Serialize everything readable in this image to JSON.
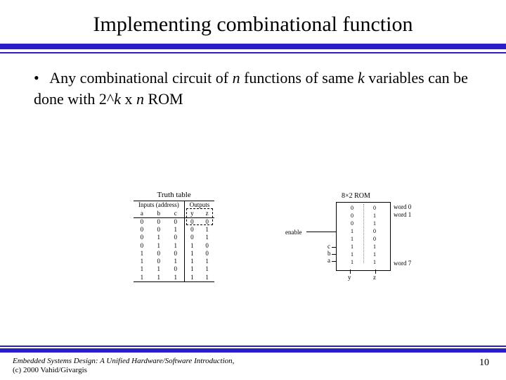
{
  "title": "Implementing combinational function",
  "bullet": {
    "marker": "•",
    "text_a": "Any combinational circuit of ",
    "n": "n",
    "text_b": " functions of same ",
    "k": "k",
    "text_c": " variables can be done with 2^",
    "k2": "k",
    "text_d": " x ",
    "n2": "n",
    "text_e": " ROM"
  },
  "truth_table": {
    "title": "Truth table",
    "group_inputs": "Inputs (address)",
    "group_outputs": "Outputs",
    "cols": {
      "a": "a",
      "b": "b",
      "c": "c",
      "y": "y",
      "z": "z"
    },
    "rows": [
      {
        "a": "0",
        "b": "0",
        "c": "0",
        "y": "0",
        "z": "0"
      },
      {
        "a": "0",
        "b": "0",
        "c": "1",
        "y": "0",
        "z": "1"
      },
      {
        "a": "0",
        "b": "1",
        "c": "0",
        "y": "0",
        "z": "1"
      },
      {
        "a": "0",
        "b": "1",
        "c": "1",
        "y": "1",
        "z": "0"
      },
      {
        "a": "1",
        "b": "0",
        "c": "0",
        "y": "1",
        "z": "0"
      },
      {
        "a": "1",
        "b": "0",
        "c": "1",
        "y": "1",
        "z": "1"
      },
      {
        "a": "1",
        "b": "1",
        "c": "0",
        "y": "1",
        "z": "1"
      },
      {
        "a": "1",
        "b": "1",
        "c": "1",
        "y": "1",
        "z": "1"
      }
    ]
  },
  "rom": {
    "title": "8×2 ROM",
    "enable": "enable",
    "addr": {
      "a": "a",
      "b": "b",
      "c": "c"
    },
    "out": {
      "y": "y",
      "z": "z"
    },
    "words": {
      "w0": "word 0",
      "w1": "word 1",
      "w7": "word 7"
    },
    "col_y": [
      "0",
      "0",
      "0",
      "1",
      "1",
      "1",
      "1",
      "1"
    ],
    "col_z": [
      "0",
      "1",
      "1",
      "0",
      "0",
      "1",
      "1",
      "1"
    ]
  },
  "footer": {
    "cite_a": "Embedded Systems Design: A Unified Hardware/Software Introduction",
    "cite_b": ", (c) 2000 Vahid/Givargis",
    "page": "10"
  }
}
